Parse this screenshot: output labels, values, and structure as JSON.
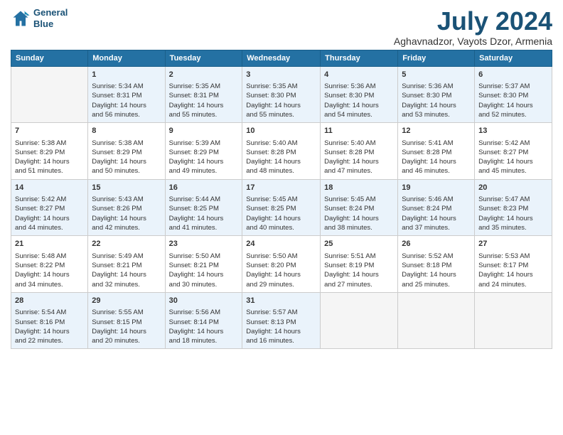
{
  "logo": {
    "line1": "General",
    "line2": "Blue"
  },
  "title": "July 2024",
  "subtitle": "Aghavnadzor, Vayots Dzor, Armenia",
  "days_header": [
    "Sunday",
    "Monday",
    "Tuesday",
    "Wednesday",
    "Thursday",
    "Friday",
    "Saturday"
  ],
  "weeks": [
    [
      {
        "day": "",
        "content": ""
      },
      {
        "day": "1",
        "content": "Sunrise: 5:34 AM\nSunset: 8:31 PM\nDaylight: 14 hours\nand 56 minutes."
      },
      {
        "day": "2",
        "content": "Sunrise: 5:35 AM\nSunset: 8:31 PM\nDaylight: 14 hours\nand 55 minutes."
      },
      {
        "day": "3",
        "content": "Sunrise: 5:35 AM\nSunset: 8:30 PM\nDaylight: 14 hours\nand 55 minutes."
      },
      {
        "day": "4",
        "content": "Sunrise: 5:36 AM\nSunset: 8:30 PM\nDaylight: 14 hours\nand 54 minutes."
      },
      {
        "day": "5",
        "content": "Sunrise: 5:36 AM\nSunset: 8:30 PM\nDaylight: 14 hours\nand 53 minutes."
      },
      {
        "day": "6",
        "content": "Sunrise: 5:37 AM\nSunset: 8:30 PM\nDaylight: 14 hours\nand 52 minutes."
      }
    ],
    [
      {
        "day": "7",
        "content": "Sunrise: 5:38 AM\nSunset: 8:29 PM\nDaylight: 14 hours\nand 51 minutes."
      },
      {
        "day": "8",
        "content": "Sunrise: 5:38 AM\nSunset: 8:29 PM\nDaylight: 14 hours\nand 50 minutes."
      },
      {
        "day": "9",
        "content": "Sunrise: 5:39 AM\nSunset: 8:29 PM\nDaylight: 14 hours\nand 49 minutes."
      },
      {
        "day": "10",
        "content": "Sunrise: 5:40 AM\nSunset: 8:28 PM\nDaylight: 14 hours\nand 48 minutes."
      },
      {
        "day": "11",
        "content": "Sunrise: 5:40 AM\nSunset: 8:28 PM\nDaylight: 14 hours\nand 47 minutes."
      },
      {
        "day": "12",
        "content": "Sunrise: 5:41 AM\nSunset: 8:28 PM\nDaylight: 14 hours\nand 46 minutes."
      },
      {
        "day": "13",
        "content": "Sunrise: 5:42 AM\nSunset: 8:27 PM\nDaylight: 14 hours\nand 45 minutes."
      }
    ],
    [
      {
        "day": "14",
        "content": "Sunrise: 5:42 AM\nSunset: 8:27 PM\nDaylight: 14 hours\nand 44 minutes."
      },
      {
        "day": "15",
        "content": "Sunrise: 5:43 AM\nSunset: 8:26 PM\nDaylight: 14 hours\nand 42 minutes."
      },
      {
        "day": "16",
        "content": "Sunrise: 5:44 AM\nSunset: 8:25 PM\nDaylight: 14 hours\nand 41 minutes."
      },
      {
        "day": "17",
        "content": "Sunrise: 5:45 AM\nSunset: 8:25 PM\nDaylight: 14 hours\nand 40 minutes."
      },
      {
        "day": "18",
        "content": "Sunrise: 5:45 AM\nSunset: 8:24 PM\nDaylight: 14 hours\nand 38 minutes."
      },
      {
        "day": "19",
        "content": "Sunrise: 5:46 AM\nSunset: 8:24 PM\nDaylight: 14 hours\nand 37 minutes."
      },
      {
        "day": "20",
        "content": "Sunrise: 5:47 AM\nSunset: 8:23 PM\nDaylight: 14 hours\nand 35 minutes."
      }
    ],
    [
      {
        "day": "21",
        "content": "Sunrise: 5:48 AM\nSunset: 8:22 PM\nDaylight: 14 hours\nand 34 minutes."
      },
      {
        "day": "22",
        "content": "Sunrise: 5:49 AM\nSunset: 8:21 PM\nDaylight: 14 hours\nand 32 minutes."
      },
      {
        "day": "23",
        "content": "Sunrise: 5:50 AM\nSunset: 8:21 PM\nDaylight: 14 hours\nand 30 minutes."
      },
      {
        "day": "24",
        "content": "Sunrise: 5:50 AM\nSunset: 8:20 PM\nDaylight: 14 hours\nand 29 minutes."
      },
      {
        "day": "25",
        "content": "Sunrise: 5:51 AM\nSunset: 8:19 PM\nDaylight: 14 hours\nand 27 minutes."
      },
      {
        "day": "26",
        "content": "Sunrise: 5:52 AM\nSunset: 8:18 PM\nDaylight: 14 hours\nand 25 minutes."
      },
      {
        "day": "27",
        "content": "Sunrise: 5:53 AM\nSunset: 8:17 PM\nDaylight: 14 hours\nand 24 minutes."
      }
    ],
    [
      {
        "day": "28",
        "content": "Sunrise: 5:54 AM\nSunset: 8:16 PM\nDaylight: 14 hours\nand 22 minutes."
      },
      {
        "day": "29",
        "content": "Sunrise: 5:55 AM\nSunset: 8:15 PM\nDaylight: 14 hours\nand 20 minutes."
      },
      {
        "day": "30",
        "content": "Sunrise: 5:56 AM\nSunset: 8:14 PM\nDaylight: 14 hours\nand 18 minutes."
      },
      {
        "day": "31",
        "content": "Sunrise: 5:57 AM\nSunset: 8:13 PM\nDaylight: 14 hours\nand 16 minutes."
      },
      {
        "day": "",
        "content": ""
      },
      {
        "day": "",
        "content": ""
      },
      {
        "day": "",
        "content": ""
      }
    ]
  ]
}
